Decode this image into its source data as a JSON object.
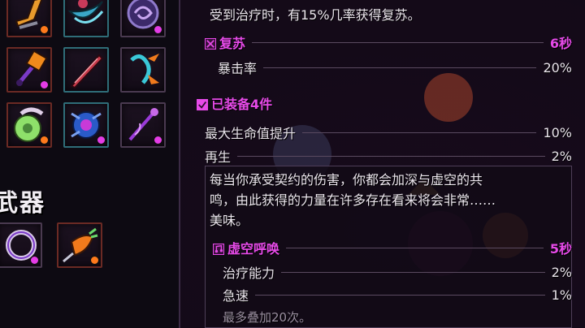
{
  "weapons_section": {
    "title": "武器"
  },
  "top_description": "受到治疗时，有15%几率获得复苏。",
  "revive": {
    "name": "复苏",
    "duration": "6秒",
    "stat_label": "暴击率",
    "stat_value": "20%"
  },
  "equipped": {
    "label": "已装备4件"
  },
  "set_stats": [
    {
      "label": "最大生命值提升",
      "value": "10%"
    },
    {
      "label": "再生",
      "value": "2%"
    }
  ],
  "void_description": {
    "line1": "每当你承受契约的伤害，你都会加深与虚空的共",
    "line2": "鸣，由此获得的力量在许多存在看来将会非常……",
    "line3": "美味。"
  },
  "void_call": {
    "name": "虚空呼唤",
    "duration": "5秒",
    "stats": [
      {
        "label": "治疗能力",
        "value": "2%"
      },
      {
        "label": "急速",
        "value": "1%"
      }
    ],
    "stack_note": "最多叠加20次。"
  },
  "colors": {
    "accent": "#e64ae8",
    "rarity_orange": "#ff7a1c",
    "rarity_magenta": "#e43ce6"
  },
  "icons": [
    "crossed-swords-icon",
    "music-note-icon",
    "checkbox-icon"
  ]
}
